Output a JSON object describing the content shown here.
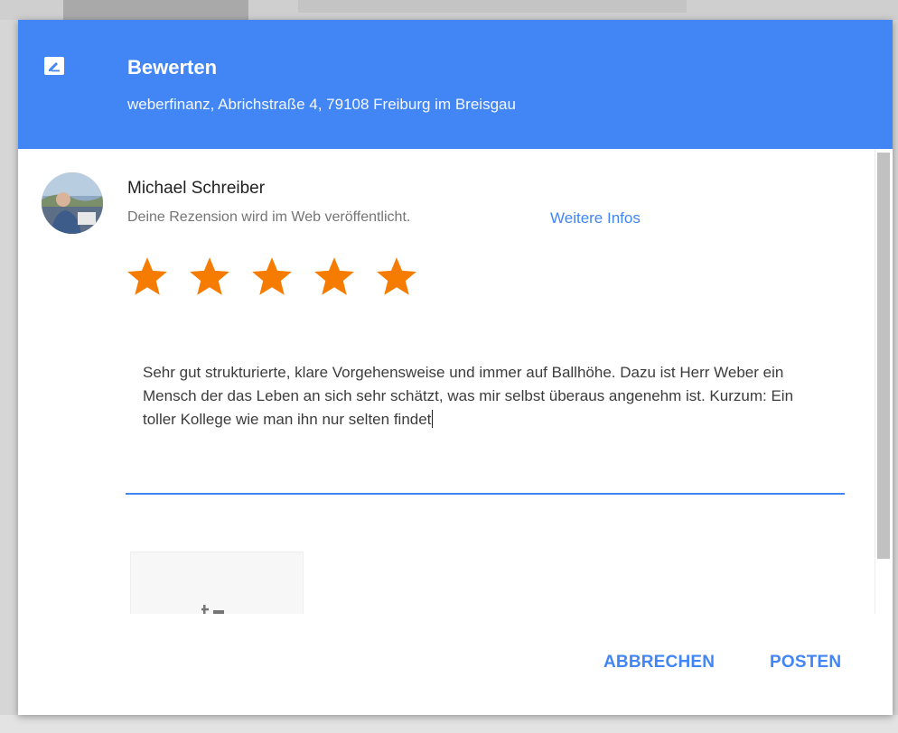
{
  "dialog": {
    "title": "Bewerten",
    "subtitle": "weberfinanz, Abrichstraße 4, 79108 Freiburg im Breisgau",
    "header_color": "#4285f4",
    "header_icon": "rate-review-icon"
  },
  "user": {
    "name": "Michael Schreiber",
    "avatar_icon": "avatar"
  },
  "notice": {
    "text": "Deine Rezension wird im Web veröffentlicht.",
    "link_label": "Weitere Infos"
  },
  "rating": {
    "value": 5,
    "max": 5,
    "star_color": "#f57c00"
  },
  "review": {
    "text": "Sehr gut strukturierte, klare Vorgehensweise und immer auf Ballhöhe. Dazu ist Herr Weber ein Mensch der das Leben an sich sehr schätzt, was mir selbst überaus angenehm ist. Kurzum: Ein toller Kollege wie man ihn nur selten findet"
  },
  "photo": {
    "icon": "add-photo-icon"
  },
  "actions": {
    "cancel_label": "ABBRECHEN",
    "post_label": "POSTEN",
    "accent_color": "#4285f4"
  }
}
